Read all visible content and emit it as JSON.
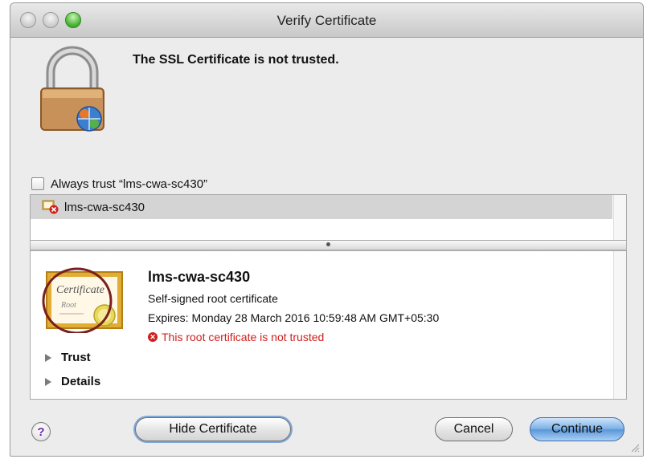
{
  "window": {
    "title": "Verify Certificate"
  },
  "header": {
    "message": "The SSL Certificate is not trusted."
  },
  "always_trust": {
    "label": "Always trust “lms-cwa-sc430”",
    "checked": false
  },
  "cert_list": {
    "items": [
      {
        "name": "lms-cwa-sc430"
      }
    ]
  },
  "cert_detail": {
    "name": "lms-cwa-sc430",
    "type": "Self-signed root certificate",
    "expires": "Expires: Monday 28 March 2016 10:59:48 AM GMT+05:30",
    "warning": "This root certificate is not trusted",
    "sections": [
      "Trust",
      "Details"
    ],
    "icon_text": {
      "line1": "Certificate",
      "line2": "Root"
    }
  },
  "buttons": {
    "help": "?",
    "hide_certificate": "Hide Certificate",
    "cancel": "Cancel",
    "continue": "Continue"
  },
  "icons": [
    "padlock-icon",
    "certificate-icon",
    "error-icon",
    "disclosure-triangle-icon",
    "help-icon",
    "resize-grip-icon"
  ],
  "colors": {
    "warning": "#d0201d",
    "default_button": "#5995d8",
    "selection": "#d4d4d4",
    "annotation_circle": "#7a1f1f"
  }
}
